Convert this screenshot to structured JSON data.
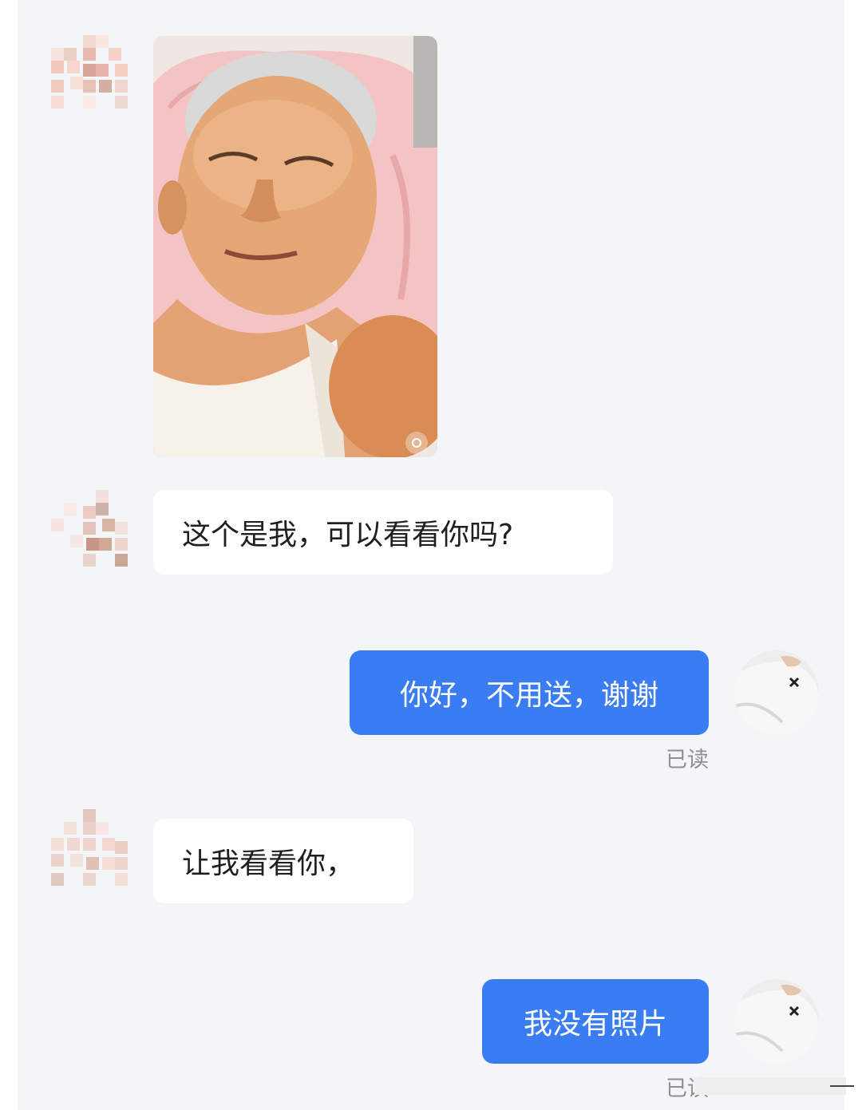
{
  "messages": [
    {
      "from": "other",
      "type": "image",
      "alt": "elderly man lying on pink pillow"
    },
    {
      "from": "other",
      "type": "text",
      "text": "这个是我，可以看看你吗?"
    },
    {
      "from": "self",
      "type": "text",
      "text": "你好，不用送，谢谢",
      "status": "已读"
    },
    {
      "from": "other",
      "type": "text",
      "text": "让我看看你，"
    },
    {
      "from": "self",
      "type": "text",
      "text": "我没有照片",
      "status": "已读"
    }
  ],
  "colors": {
    "chat_background": "#f4f5f7",
    "outgoing_bubble": "#3a7df2",
    "incoming_bubble": "#ffffff",
    "status_text": "#8e8e93"
  },
  "icons": {
    "photo_badge": "lens-icon",
    "self_avatar_logo": "brand-logo-icon"
  }
}
